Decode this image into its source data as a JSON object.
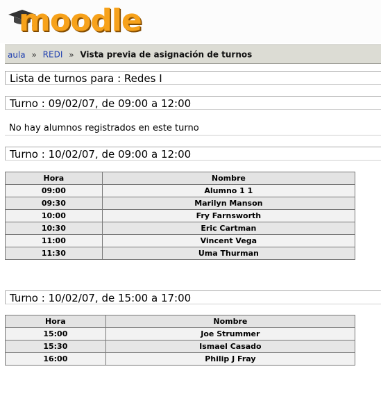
{
  "logo": {
    "text": "moodle"
  },
  "breadcrumb": {
    "items": [
      {
        "label": "aula"
      },
      {
        "label": "REDI"
      }
    ],
    "separator": "»",
    "current": "Vista previa de asignación de turnos"
  },
  "page": {
    "title": "Lista de turnos para : Redes I"
  },
  "slots": [
    {
      "heading": "Turno : 09/02/07, de 09:00 a 12:00",
      "message": "No hay alumnos registrados en este turno"
    },
    {
      "heading": "Turno : 10/02/07, de 09:00 a 12:00",
      "columns": [
        "Hora",
        "Nombre"
      ],
      "rows": [
        {
          "hora": "09:00",
          "nombre": "Alumno 1 1"
        },
        {
          "hora": "09:30",
          "nombre": "Marilyn Manson"
        },
        {
          "hora": "10:00",
          "nombre": "Fry Farnsworth"
        },
        {
          "hora": "10:30",
          "nombre": "Eric Cartman"
        },
        {
          "hora": "11:00",
          "nombre": "Vincent Vega"
        },
        {
          "hora": "11:30",
          "nombre": "Uma Thurman"
        }
      ]
    },
    {
      "heading": "Turno : 10/02/07, de 15:00 a 17:00",
      "columns": [
        "Hora",
        "Nombre"
      ],
      "rows": [
        {
          "hora": "15:00",
          "nombre": "Joe Strummer"
        },
        {
          "hora": "15:30",
          "nombre": "Ismael Casado"
        },
        {
          "hora": "16:00",
          "nombre": "Philip J Fray"
        }
      ]
    }
  ],
  "colors": {
    "logo_orange": "#f7a21b",
    "link_blue": "#1f3fb0",
    "navbar_bg": "#dcdcd4"
  },
  "icons": {
    "logo_cap": "graduation-cap-icon"
  }
}
